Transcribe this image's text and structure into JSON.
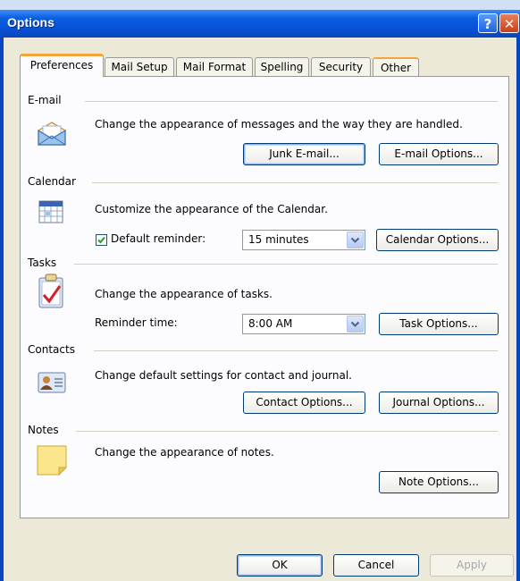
{
  "window": {
    "title": "Options",
    "help_glyph": "?",
    "close_glyph": "✕"
  },
  "tabs": [
    {
      "label": "Preferences",
      "active": true
    },
    {
      "label": "Mail Setup",
      "active": false
    },
    {
      "label": "Mail Format",
      "active": false
    },
    {
      "label": "Spelling",
      "active": false
    },
    {
      "label": "Security",
      "active": false
    },
    {
      "label": "Other",
      "active": false
    }
  ],
  "email": {
    "label": "E-mail",
    "icon": "envelope-icon",
    "description": "Change the appearance of messages and the way they are handled.",
    "junk_button": "Junk E-mail...",
    "options_button": "E-mail Options..."
  },
  "calendar": {
    "label": "Calendar",
    "icon": "calendar-icon",
    "description": "Customize the appearance of the Calendar.",
    "reminder_checked": true,
    "reminder_label": "Default reminder:",
    "reminder_value": "15 minutes",
    "options_button": "Calendar Options..."
  },
  "tasks": {
    "label": "Tasks",
    "icon": "task-clipboard-icon",
    "description": "Change the appearance of tasks.",
    "reminder_label": "Reminder time:",
    "reminder_value": "8:00 AM",
    "options_button": "Task Options..."
  },
  "contacts": {
    "label": "Contacts",
    "icon": "contact-card-icon",
    "description": "Change default settings for contact and journal.",
    "contact_button": "Contact Options...",
    "journal_button": "Journal Options..."
  },
  "notes": {
    "label": "Notes",
    "icon": "note-icon",
    "description": "Change the appearance of notes.",
    "options_button": "Note Options..."
  },
  "footer": {
    "ok": "OK",
    "cancel": "Cancel",
    "apply": "Apply"
  },
  "colors": {
    "title_bar": "#0750d6",
    "active_tab_accent": "#f3a43a",
    "dialog_face": "#ece9d8"
  }
}
